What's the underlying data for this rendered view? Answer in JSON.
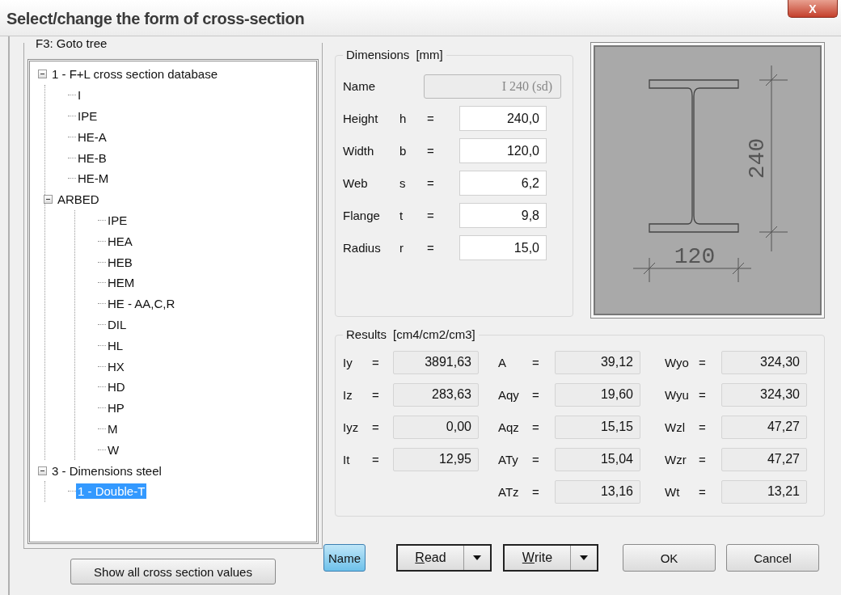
{
  "window": {
    "title": "Select/change the form of cross-section",
    "close": "X"
  },
  "tree": {
    "label": "F3: Goto tree",
    "items": [
      {
        "label": "1 - F+L cross section database",
        "expanded": true,
        "selected": false,
        "children": [
          {
            "label": "I",
            "selected": false
          },
          {
            "label": "IPE",
            "selected": false
          },
          {
            "label": "HE-A",
            "selected": false
          },
          {
            "label": "HE-B",
            "selected": false
          },
          {
            "label": "HE-M",
            "selected": false
          },
          {
            "label": "ARBED",
            "expanded": true,
            "selected": false,
            "children": [
              {
                "label": "IPE",
                "selected": false
              },
              {
                "label": "HEA",
                "selected": false
              },
              {
                "label": "HEB",
                "selected": false
              },
              {
                "label": "HEM",
                "selected": false
              },
              {
                "label": "HE - AA,C,R",
                "selected": false
              },
              {
                "label": "DIL",
                "selected": false
              },
              {
                "label": "HL",
                "selected": false
              },
              {
                "label": "HX",
                "selected": false
              },
              {
                "label": "HD",
                "selected": false
              },
              {
                "label": "HP",
                "selected": false
              },
              {
                "label": "M",
                "selected": false
              },
              {
                "label": "W",
                "selected": false
              }
            ]
          }
        ]
      },
      {
        "label": "3 - Dimensions steel",
        "expanded": true,
        "selected": false,
        "children": [
          {
            "label": "1 - Double-T",
            "selected": true
          }
        ]
      }
    ]
  },
  "show_all_button": "Show all cross section values",
  "dimensions": {
    "legend": "Dimensions",
    "unit": "[mm]",
    "name": {
      "label": "Name",
      "value": "I 240 (sd)",
      "disabled": true
    },
    "rows": [
      {
        "label": "Height",
        "symbol": "h",
        "equals": "=",
        "value": "240,0"
      },
      {
        "label": "Width",
        "symbol": "b",
        "equals": "=",
        "value": "120,0"
      },
      {
        "label": "Web",
        "symbol": "s",
        "equals": "=",
        "value": "6,2"
      },
      {
        "label": "Flange",
        "symbol": "t",
        "equals": "=",
        "value": "9,8"
      },
      {
        "label": "Radius",
        "symbol": "r",
        "equals": "=",
        "value": "15,0"
      }
    ]
  },
  "drawing": {
    "height_label": "240",
    "width_label": "120"
  },
  "results": {
    "legend": "Results",
    "unit": "[cm4/cm2/cm3]",
    "columns": [
      [
        {
          "symbol": "Iy",
          "equals": "=",
          "value": "3891,63"
        },
        {
          "symbol": "Iz",
          "equals": "=",
          "value": "283,63"
        },
        {
          "symbol": "Iyz",
          "equals": "=",
          "value": "0,00"
        },
        {
          "symbol": "It",
          "equals": "=",
          "value": "12,95"
        }
      ],
      [
        {
          "symbol": "A",
          "equals": "=",
          "value": "39,12"
        },
        {
          "symbol": "Aqy",
          "equals": "=",
          "value": "19,60"
        },
        {
          "symbol": "Aqz",
          "equals": "=",
          "value": "15,15"
        },
        {
          "symbol": "ATy",
          "equals": "=",
          "value": "15,04"
        },
        {
          "symbol": "ATz",
          "equals": "=",
          "value": "13,16"
        }
      ],
      [
        {
          "symbol": "Wyo",
          "equals": "=",
          "value": "324,30"
        },
        {
          "symbol": "Wyu",
          "equals": "=",
          "value": "324,30"
        },
        {
          "symbol": "Wzl",
          "equals": "=",
          "value": "47,27"
        },
        {
          "symbol": "Wzr",
          "equals": "=",
          "value": "47,27"
        },
        {
          "symbol": "Wt",
          "equals": "=",
          "value": "13,21"
        }
      ]
    ]
  },
  "buttons": [
    {
      "label": "Name",
      "kind": "toggle",
      "selected": true
    },
    {
      "label": "Read",
      "kind": "split",
      "mnemonic": true
    },
    {
      "label": "Write",
      "kind": "split",
      "mnemonic": true
    },
    {
      "label": "OK",
      "kind": "plain"
    },
    {
      "label": "Cancel",
      "kind": "plain"
    }
  ]
}
